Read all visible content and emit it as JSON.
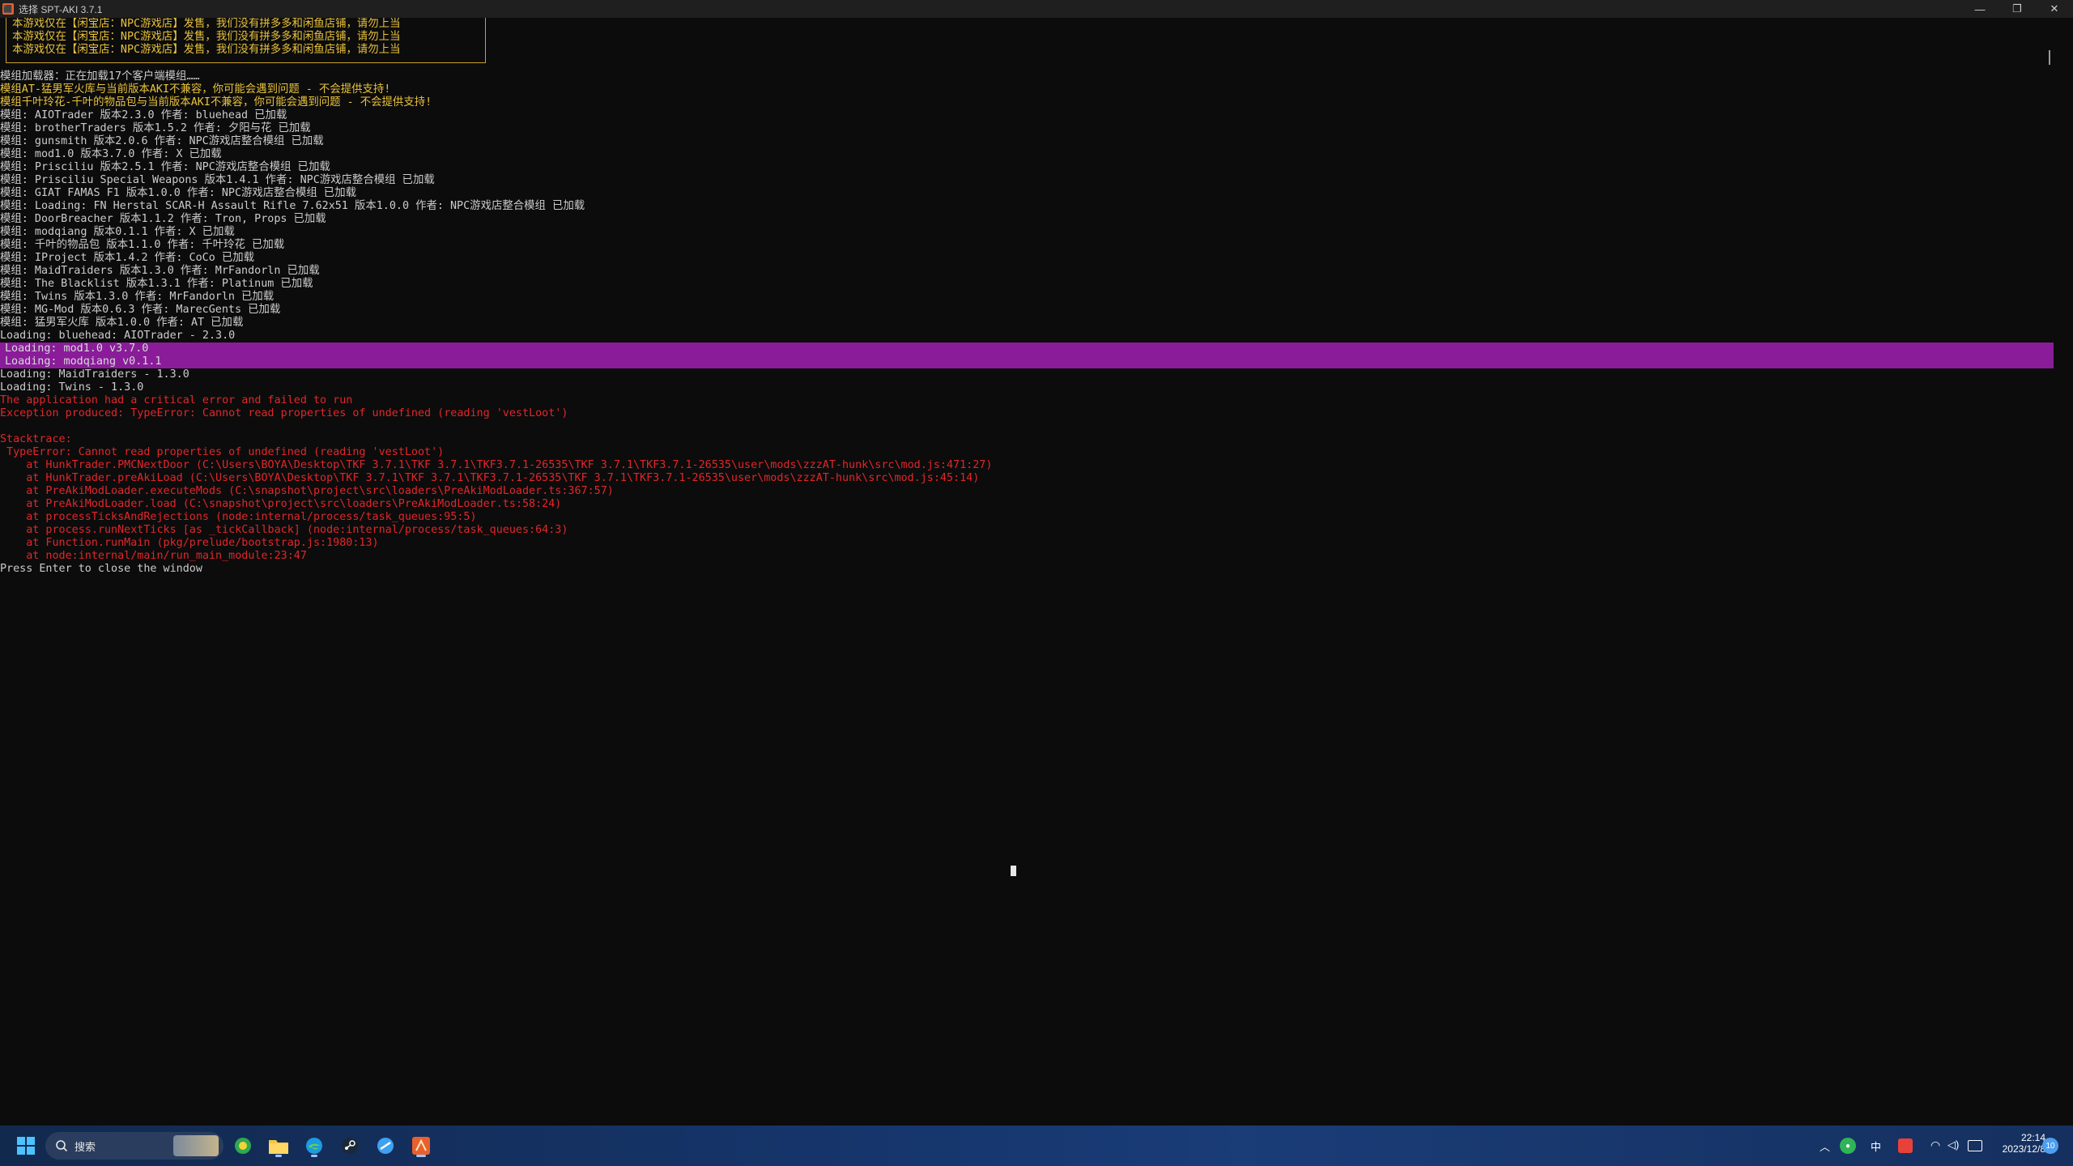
{
  "window": {
    "title": "选择 SPT-AKI 3.7.1",
    "icon": "spt-app-icon",
    "controls": [
      "—",
      "❐",
      "✕"
    ]
  },
  "notice": [
    "本游戏仅在【闲宝店：NPC游戏店】发售，我们没有拼多多和闲鱼店铺，请勿上当",
    "本游戏仅在【闲宝店：NPC游戏店】发售，我们没有拼多多和闲鱼店铺，请勿上当",
    "本游戏仅在【闲宝店：NPC游戏店】发售，我们没有拼多多和闲鱼店铺，请勿上当"
  ],
  "console_lines": [
    {
      "text": "模组加载器：正在加载17个客户端模组……",
      "color": "white"
    },
    {
      "text": "模组AT-猛男军火库与当前版本AKI不兼容，你可能会遇到问题 - 不会提供支持!",
      "color": "yellow"
    },
    {
      "text": "模组千叶玲花-千叶的物品包与当前版本AKI不兼容，你可能会遇到问题 - 不会提供支持!",
      "color": "yellow"
    },
    {
      "text": "模组: AIOTrader 版本2.3.0 作者: bluehead 已加载",
      "color": "white"
    },
    {
      "text": "模组: brotherTraders 版本1.5.2 作者: 夕阳与花 已加载",
      "color": "white"
    },
    {
      "text": "模组: gunsmith 版本2.0.6 作者: NPC游戏店整合模组 已加载",
      "color": "white"
    },
    {
      "text": "模组: mod1.0 版本3.7.0 作者: X 已加载",
      "color": "white"
    },
    {
      "text": "模组: Prisciliu 版本2.5.1 作者: NPC游戏店整合模组 已加载",
      "color": "white"
    },
    {
      "text": "模组: Prisciliu Special Weapons 版本1.4.1 作者: NPC游戏店整合模组 已加载",
      "color": "white"
    },
    {
      "text": "模组: GIAT FAMAS F1 版本1.0.0 作者: NPC游戏店整合模组 已加载",
      "color": "white"
    },
    {
      "text": "模组: Loading: FN Herstal SCAR-H Assault Rifle 7.62x51 版本1.0.0 作者: NPC游戏店整合模组 已加载",
      "color": "white"
    },
    {
      "text": "模组: DoorBreacher 版本1.1.2 作者: Tron, Props 已加载",
      "color": "white"
    },
    {
      "text": "模组: modqiang 版本0.1.1 作者: X 已加载",
      "color": "white"
    },
    {
      "text": "模组: 千叶的物品包 版本1.1.0 作者: 千叶玲花 已加载",
      "color": "white"
    },
    {
      "text": "模组: IProject 版本1.4.2 作者: CoCo 已加载",
      "color": "white"
    },
    {
      "text": "模组: MaidTraiders 版本1.3.0 作者: MrFandorln 已加载",
      "color": "white"
    },
    {
      "text": "模组: The Blacklist 版本1.3.1 作者: Platinum 已加载",
      "color": "white"
    },
    {
      "text": "模组: Twins 版本1.3.0 作者: MrFandorln 已加载",
      "color": "white"
    },
    {
      "text": "模组: MG-Mod 版本0.6.3 作者: MarecGents 已加载",
      "color": "white"
    },
    {
      "text": "模组: 猛男军火库 版本1.0.0 作者: AT 已加载",
      "color": "white"
    },
    {
      "text": "Loading: bluehead: AIOTrader - 2.3.0",
      "color": "white"
    }
  ],
  "highlighted_lines": [
    "Loading: mod1.0 v3.7.0",
    "Loading: modqiang v0.1.1"
  ],
  "after_lines": [
    {
      "text": "Loading: MaidTraiders - 1.3.0",
      "color": "white"
    },
    {
      "text": "Loading: Twins - 1.3.0",
      "color": "white"
    },
    {
      "text": "The application had a critical error and failed to run",
      "color": "red"
    },
    {
      "text": "Exception produced: TypeError: Cannot read properties of undefined (reading 'vestLoot')",
      "color": "red"
    },
    {
      "text": "",
      "color": "white"
    },
    {
      "text": "Stacktrace:",
      "color": "red"
    },
    {
      "text": " TypeError: Cannot read properties of undefined (reading 'vestLoot')",
      "color": "red"
    },
    {
      "text": "    at HunkTrader.PMCNextDoor (C:\\Users\\BOYA\\Desktop\\TKF 3.7.1\\TKF 3.7.1\\TKF3.7.1-26535\\TKF 3.7.1\\TKF3.7.1-26535\\user\\mods\\zzzAT-hunk\\src\\mod.js:471:27)",
      "color": "red"
    },
    {
      "text": "    at HunkTrader.preAkiLoad (C:\\Users\\BOYA\\Desktop\\TKF 3.7.1\\TKF 3.7.1\\TKF3.7.1-26535\\TKF 3.7.1\\TKF3.7.1-26535\\user\\mods\\zzzAT-hunk\\src\\mod.js:45:14)",
      "color": "red"
    },
    {
      "text": "    at PreAkiModLoader.executeMods (C:\\snapshot\\project\\src\\loaders\\PreAkiModLoader.ts:367:57)",
      "color": "red"
    },
    {
      "text": "    at PreAkiModLoader.load (C:\\snapshot\\project\\src\\loaders\\PreAkiModLoader.ts:58:24)",
      "color": "red"
    },
    {
      "text": "    at processTicksAndRejections (node:internal/process/task_queues:95:5)",
      "color": "red"
    },
    {
      "text": "    at process.runNextTicks [as _tickCallback] (node:internal/process/task_queues:64:3)",
      "color": "red"
    },
    {
      "text": "    at Function.runMain (pkg/prelude/bootstrap.js:1980:13)",
      "color": "red"
    },
    {
      "text": "    at node:internal/main/run_main_module:23:47",
      "color": "red"
    },
    {
      "text": "Press Enter to close the window",
      "color": "white"
    }
  ],
  "taskbar": {
    "search_label": "搜索",
    "tray": {
      "ime": "中",
      "time": "22:14",
      "date": "2023/12/8",
      "notification_count": "10"
    }
  }
}
